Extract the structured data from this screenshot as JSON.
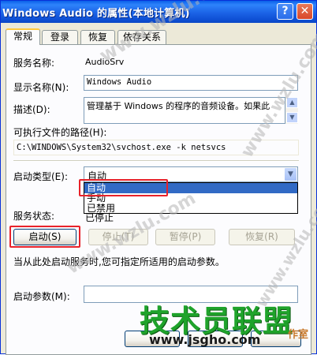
{
  "window": {
    "title": "Windows Audio 的属性(本地计算机)",
    "help_glyph": "?",
    "close_glyph": "✕"
  },
  "tabs": [
    {
      "label": "常规",
      "active": true
    },
    {
      "label": "登录",
      "active": false
    },
    {
      "label": "恢复",
      "active": false
    },
    {
      "label": "依存关系",
      "active": false
    }
  ],
  "general": {
    "service_name_label": "服务名称:",
    "service_name_value": "AudioSrv",
    "display_name_label": "显示名称(N):",
    "display_name_value": "Windows Audio",
    "description_label": "描述(D):",
    "description_value": "管理基于 Windows 的程序的音频设备。如果此",
    "exe_path_label": "可执行文件的路径(H):",
    "exe_path_value": "C:\\WINDOWS\\System32\\svchost.exe -k netsvcs",
    "startup_type_label": "启动类型(E):",
    "startup_type_value": "自动",
    "startup_options": [
      "自动",
      "手动",
      "已禁用"
    ],
    "service_status_label": "服务状态:",
    "service_status_value": "已停止",
    "buttons": {
      "start": "启动(S)",
      "stop": "停止(T)",
      "pause": "暂停(P)",
      "resume": "恢复(R)"
    },
    "hint": "当从此处启动服务时,您可指定所适用的启动参数。",
    "start_params_label": "启动参数(M):",
    "start_params_value": ""
  },
  "watermarks": {
    "site_repeat": "www.wzlu.com",
    "brand": "技术员联盟",
    "url": "www.jsgho.com",
    "tag": "作室"
  },
  "colors": {
    "titlebar": "#0A5FE8",
    "highlight_box": "#E8222A",
    "selection": "#316AC5",
    "brand_green": "#1FA32B"
  }
}
